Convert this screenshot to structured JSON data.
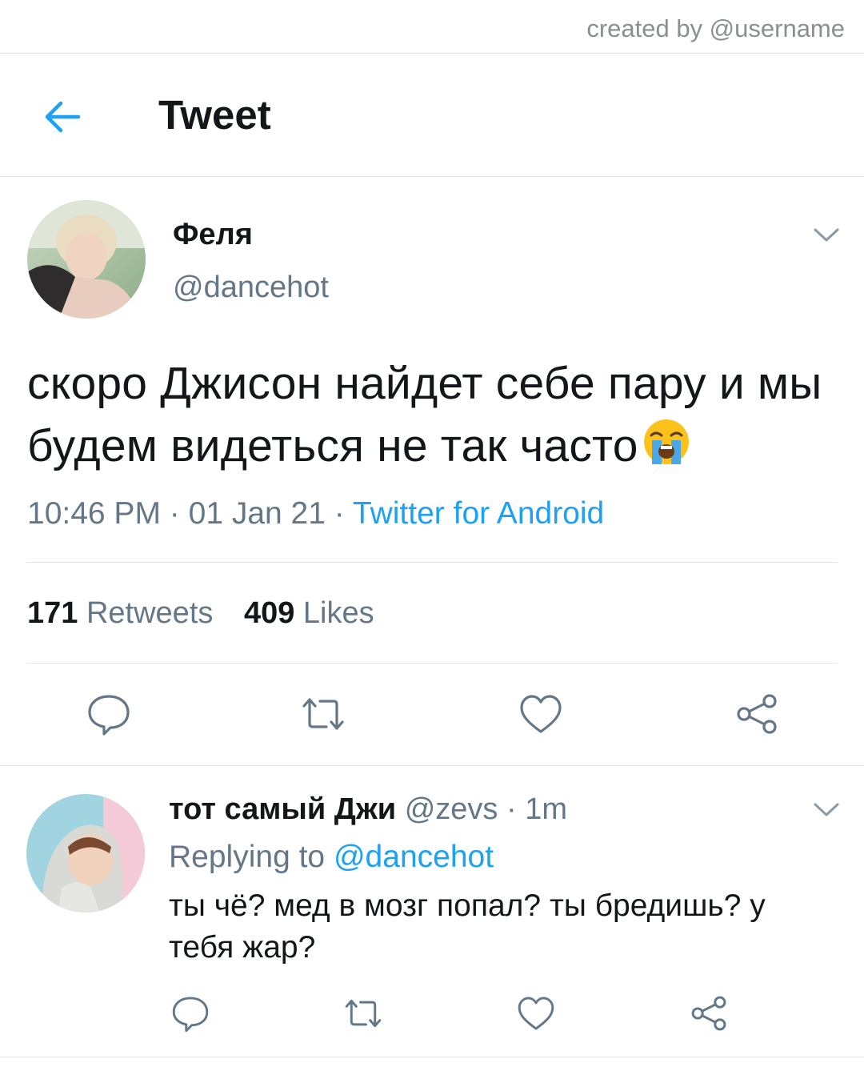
{
  "credit": "created by @username",
  "header": {
    "title": "Tweet"
  },
  "tweet": {
    "author_name": "Феля",
    "author_handle": "@dancehot",
    "text": "скоро Джисон найдет себе пару и мы будем видеться не так часто",
    "emoji": "loudly-crying-face-emoji",
    "time": "10:46 PM",
    "date": "01 Jan 21",
    "source": "Twitter for Android",
    "retweets_count": "171",
    "retweets_label": "Retweets",
    "likes_count": "409",
    "likes_label": "Likes"
  },
  "reply": {
    "author_name": "тот самый Джи",
    "author_handle": "@zevs",
    "time_ago": "1m",
    "replying_prefix": "Replying to",
    "replying_handle": "@dancehot",
    "text": "ты чё? мед в мозг попал? ты бредишь? у тебя жар?"
  },
  "icons": [
    "back-arrow-icon",
    "chevron-down-icon",
    "reply-icon",
    "retweet-icon",
    "like-icon",
    "share-icon"
  ],
  "colors": {
    "accent": "#1da1f2",
    "text": "#14171a",
    "muted": "#657786",
    "divider": "#e1e5e8"
  }
}
